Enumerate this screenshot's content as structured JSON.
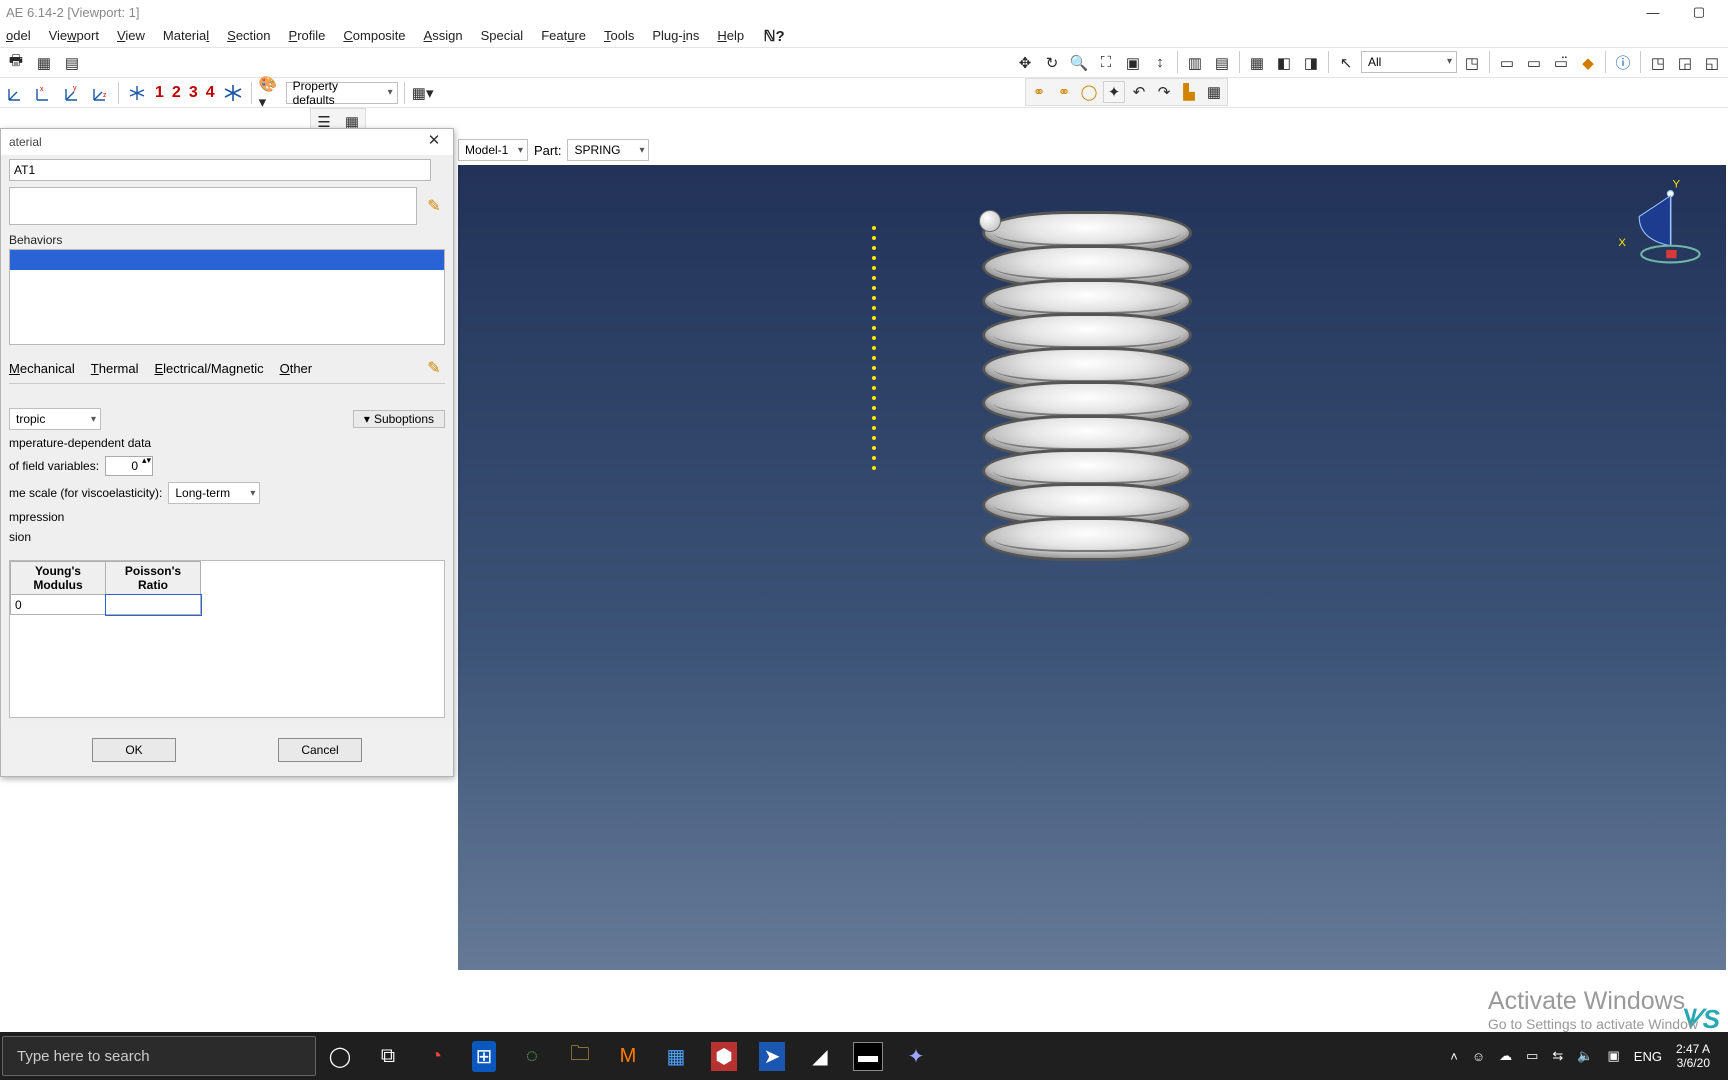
{
  "title": "AE 6.14-2  [Viewport: 1]",
  "menus": [
    "odel",
    "Viewport",
    "View",
    "Material",
    "Section",
    "Profile",
    "Composite",
    "Assign",
    "Special",
    "Feature",
    "Tools",
    "Plug-ins",
    "Help"
  ],
  "property_defaults": "Property defaults",
  "query_dropdown": "All",
  "model": {
    "label": "Model-1",
    "partLabel": "Part:",
    "part": "SPRING"
  },
  "dialog": {
    "title": "aterial",
    "name": "AT1",
    "behaviors_label": "Behaviors",
    "tabs": [
      "Mechanical",
      "Thermal",
      "Electrical/Magnetic",
      "Other"
    ],
    "type_dd": "tropic",
    "suboptions": "Suboptions",
    "temp_label": "mperature-dependent data",
    "fieldvars_label": "of field variables:",
    "fieldvars_value": "0",
    "timescale_label": "me scale (for viscoelasticity):",
    "timescale_value": "Long-term",
    "compression": "mpression",
    "tension": "sion",
    "col1": "Young's\nModulus",
    "col2": "Poisson's\nRatio",
    "cell_r1c1": "0",
    "ok": "OK",
    "cancel": "Cancel"
  },
  "triad": {
    "x": "X",
    "y": "Y"
  },
  "activate": {
    "big": "Activate Windows",
    "small": "Go to Settings to activate Window"
  },
  "taskbar": {
    "search_placeholder": "Type here to search",
    "lang": "ENG",
    "time": "2:47 A",
    "date": "3/6/20"
  },
  "numbers": [
    "1",
    "2",
    "3",
    "4"
  ]
}
